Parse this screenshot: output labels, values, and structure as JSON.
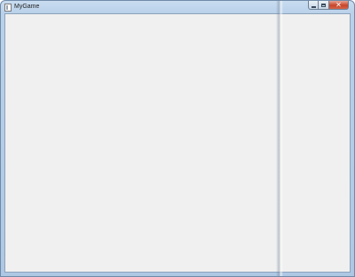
{
  "window": {
    "title": "MyGame",
    "controls": {
      "minimize_icon": "minimize-icon",
      "maximize_icon": "maximize-icon",
      "close_glyph": "✕"
    }
  },
  "colors": {
    "frame": "#b9d1ea",
    "client_background": "#f0f0f0",
    "close_button": "#c8452a"
  }
}
